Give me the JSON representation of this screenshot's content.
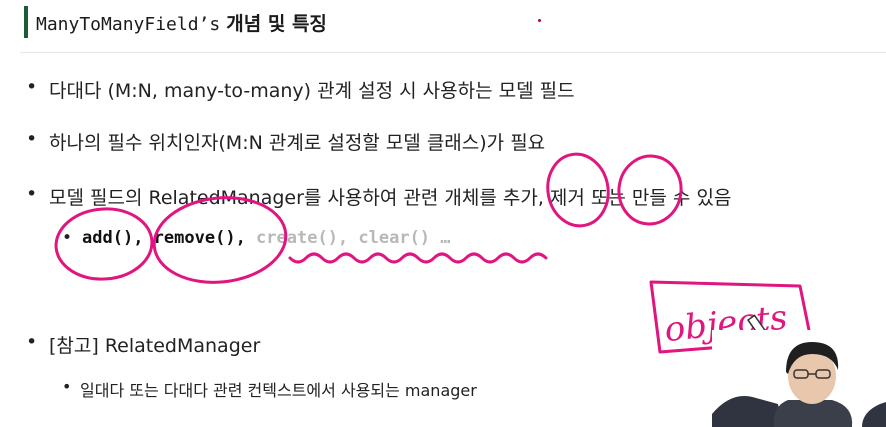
{
  "slide": {
    "title_code": "ManyToManyField’s",
    "title_ko": "개념 및 특징",
    "bullets": [
      "다대다 (M:N, many-to-many) 관계 설정 시 사용하는 모델 필드",
      "하나의 필수 위치인자(M:N 관계로 설정할 모델 클래스)가 필요",
      "모델 필드의 RelatedManager를 사용하여 관련 개체를 추가, 제거 또는 만들 수 있음"
    ],
    "methods": {
      "add": "add()",
      "sep1": ", ",
      "remove": "remove()",
      "sep2": ", ",
      "rest": "create(), clear() …"
    },
    "ref_bullet": "[참고] RelatedManager",
    "ref_sub": "일대다 또는 다대다 관련 컨텍스트에서 사용되는 manager"
  },
  "annotation": {
    "handwritten_text": "objects",
    "ink_color": "#e0157f"
  }
}
